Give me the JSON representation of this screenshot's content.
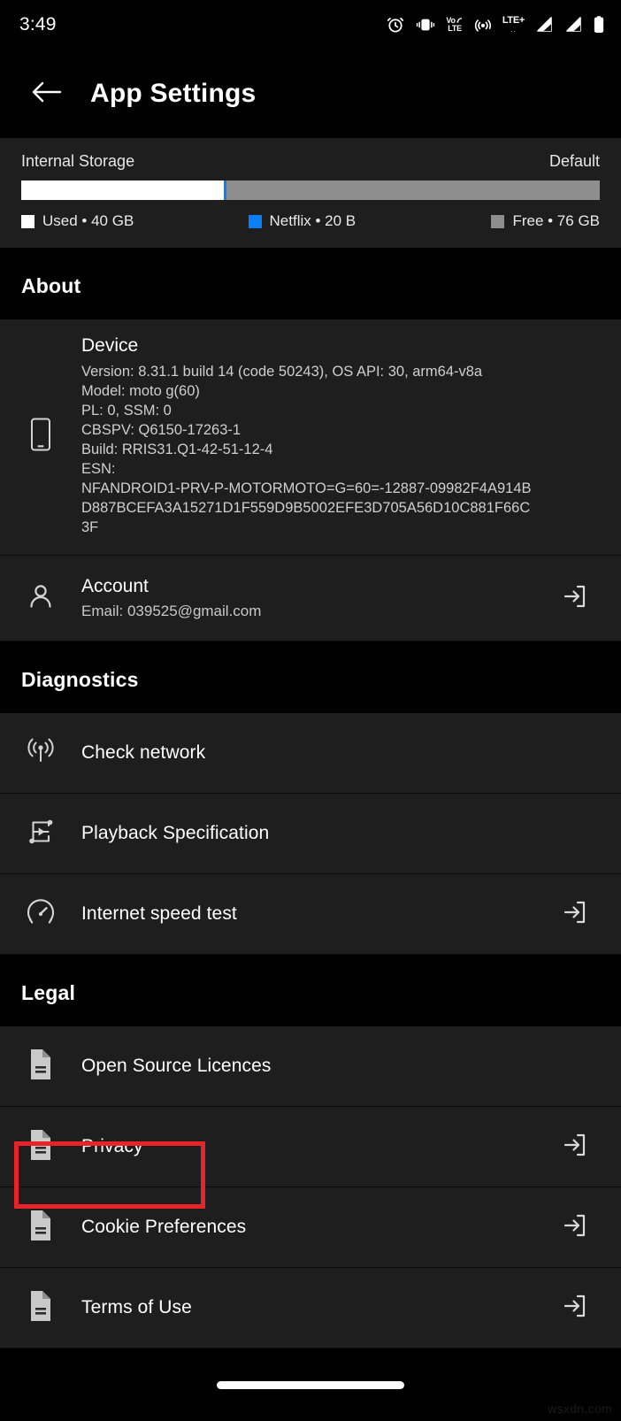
{
  "status_bar": {
    "time": "3:49",
    "icons": [
      "alarm-icon",
      "vibrate-icon",
      "volte-icon",
      "hotspot-icon",
      "lte-plus-icon",
      "signal-sim1-icon",
      "signal-sim2-icon",
      "battery-icon"
    ],
    "volte_top": "Vo",
    "volte_bottom": "LTE",
    "lte_label": "LTE+",
    "lte_dots": ".."
  },
  "app_bar": {
    "back_icon": "back-arrow-icon",
    "title": "App Settings"
  },
  "storage": {
    "title": "Internal Storage",
    "type": "Default",
    "segments": [
      {
        "key": "used",
        "percent": 35,
        "color": "#ffffff"
      },
      {
        "key": "netflix",
        "percent": 0.3,
        "color": "#0b7ef5"
      },
      {
        "key": "free",
        "percent": 64.7,
        "color": "#8e8e8e"
      }
    ],
    "legend": [
      {
        "label": "Used • 40 GB",
        "color": "#ffffff"
      },
      {
        "label": "Netflix • 20 B",
        "color": "#0b7ef5"
      },
      {
        "label": "Free • 76 GB",
        "color": "#8e8e8e"
      }
    ]
  },
  "sections": {
    "about": {
      "header": "About",
      "device": {
        "icon": "smartphone-icon",
        "title": "Device",
        "lines": [
          "Version: 8.31.1 build 14 (code 50243), OS API: 30, arm64-v8a",
          "Model: moto g(60)",
          "PL: 0, SSM: 0",
          "CBSPV: Q6150-17263-1",
          "Build: RRIS31.Q1-42-51-12-4",
          "ESN:",
          "NFANDROID1-PRV-P-MOTORMOTO=G=60=-12887-09982F4A914B",
          "D887BCEFA3A15271D1F559D9B5002EFE3D705A56D10C881F66C",
          "3F"
        ]
      },
      "account": {
        "icon": "person-icon",
        "title": "Account",
        "subtitle": "Email: 039525@gmail.com",
        "trailing_icon": "open-external-icon"
      }
    },
    "diagnostics": {
      "header": "Diagnostics",
      "items": [
        {
          "label": "Check network",
          "icon": "broadcast-signal-icon",
          "trailing_icon": null
        },
        {
          "label": "Playback Specification",
          "icon": "playback-spec-icon",
          "trailing_icon": null
        },
        {
          "label": "Internet speed test",
          "icon": "speedometer-icon",
          "trailing_icon": "open-external-icon"
        }
      ]
    },
    "legal": {
      "header": "Legal",
      "items": [
        {
          "label": "Open Source Licences",
          "icon": "document-icon",
          "trailing_icon": null,
          "highlighted": false
        },
        {
          "label": "Privacy",
          "icon": "document-icon",
          "trailing_icon": "open-external-icon",
          "highlighted": true
        },
        {
          "label": "Cookie Preferences",
          "icon": "document-icon",
          "trailing_icon": "open-external-icon",
          "highlighted": false
        },
        {
          "label": "Terms of Use",
          "icon": "document-icon",
          "trailing_icon": "open-external-icon",
          "highlighted": false
        }
      ]
    }
  },
  "highlight": {
    "color": "#e8242a",
    "target": "Privacy"
  },
  "watermark": "wsxdn.com"
}
